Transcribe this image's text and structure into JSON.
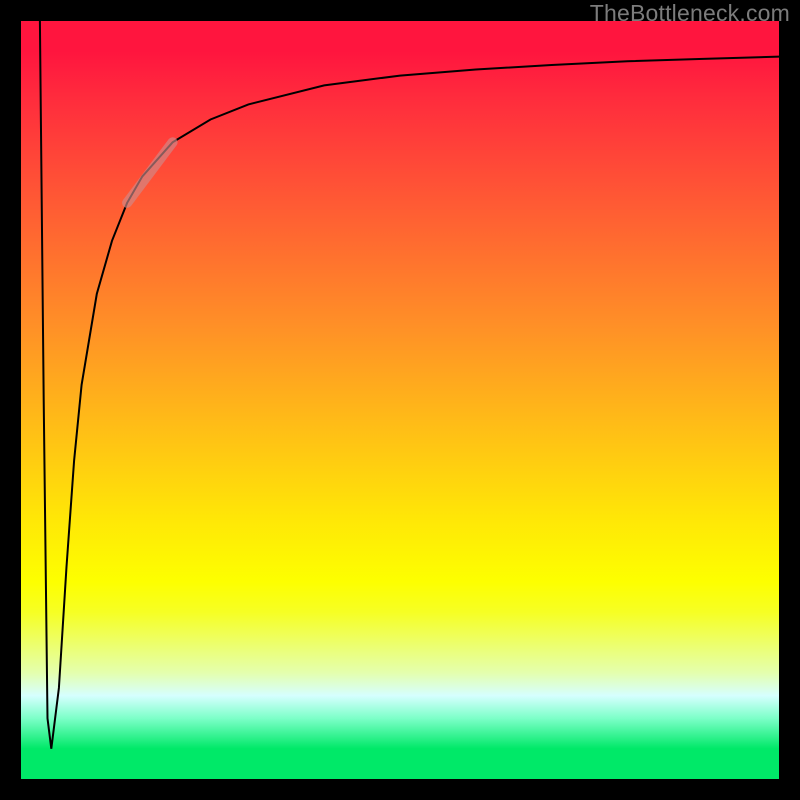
{
  "watermark": "TheBottleneck.com",
  "chart_data": {
    "type": "line",
    "title": "",
    "xlabel": "",
    "ylabel": "",
    "xlim": [
      0,
      100
    ],
    "ylim": [
      0,
      100
    ],
    "grid": false,
    "legend": false,
    "background_gradient": {
      "stops": [
        {
          "pos": 0.0,
          "color": "#ff153e"
        },
        {
          "pos": 0.24,
          "color": "#ff5a34"
        },
        {
          "pos": 0.54,
          "color": "#ffbf16"
        },
        {
          "pos": 0.74,
          "color": "#fdff00"
        },
        {
          "pos": 0.89,
          "color": "#d6ffff"
        },
        {
          "pos": 0.96,
          "color": "#00e968"
        },
        {
          "pos": 1.0,
          "color": "#00e968"
        }
      ]
    },
    "series": [
      {
        "name": "bottleneck-curve",
        "stroke": "#000000",
        "stroke_width": 2,
        "x": [
          2.5,
          3.0,
          3.5,
          4.0,
          5.0,
          6.0,
          7.0,
          8.0,
          10.0,
          12.0,
          14.0,
          16.0,
          20.0,
          25.0,
          30.0,
          40.0,
          50.0,
          60.0,
          70.0,
          80.0,
          90.0,
          100.0
        ],
        "y": [
          100.0,
          50.0,
          8.0,
          4.0,
          12.0,
          28.0,
          42.0,
          52.0,
          64.0,
          71.0,
          76.0,
          79.5,
          84.0,
          87.0,
          89.0,
          91.5,
          92.8,
          93.6,
          94.2,
          94.7,
          95.0,
          95.3
        ]
      },
      {
        "name": "highlight-segment",
        "stroke": "#cf8b8b",
        "stroke_width": 10,
        "opacity": 0.65,
        "x": [
          14.0,
          20.0
        ],
        "y": [
          76.0,
          84.0
        ]
      }
    ],
    "annotations": []
  }
}
